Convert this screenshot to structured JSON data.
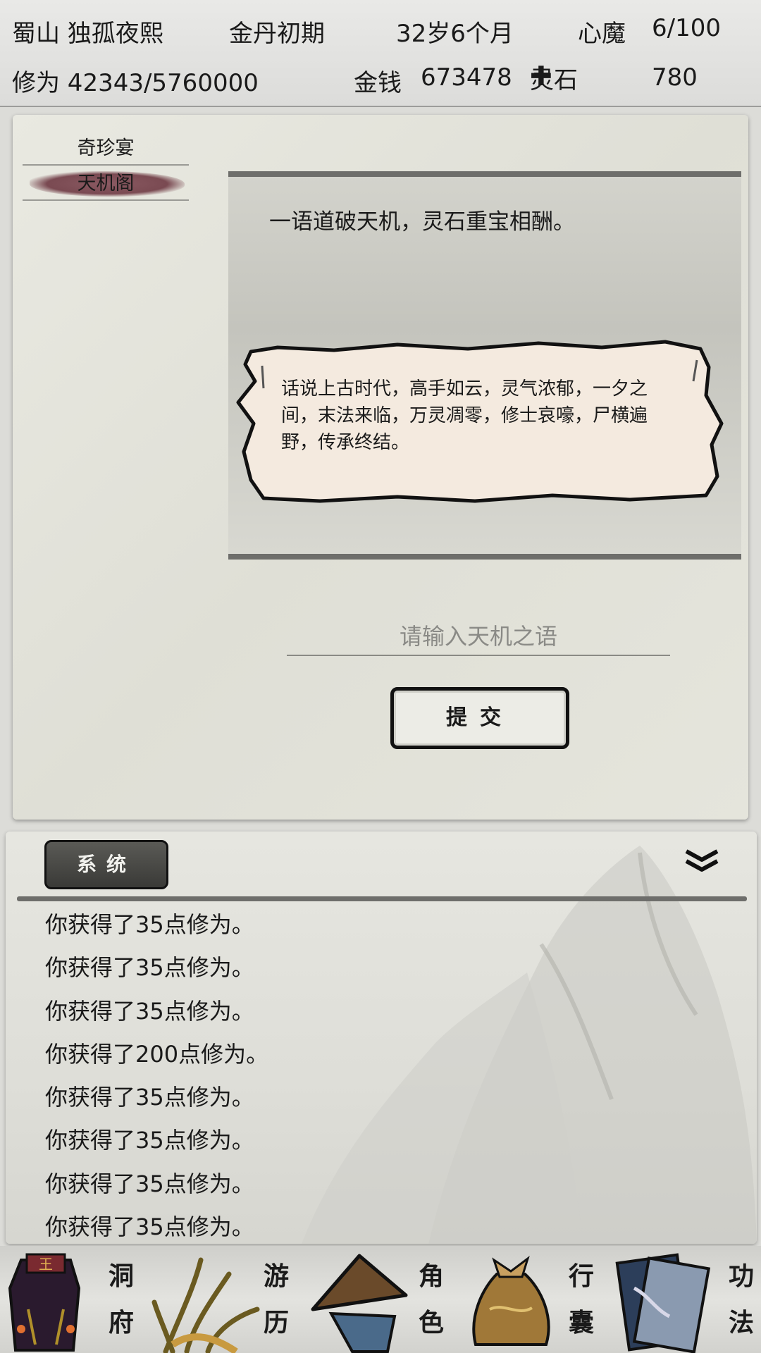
{
  "status": {
    "location_name": "蜀山 独孤夜熙",
    "realm": "金丹初期",
    "age": "32岁6个月",
    "demon_label": "心魔",
    "demon_value": "6/100",
    "cultivation": "修为 42343/5760000",
    "money_label": "金钱",
    "money_value": "673478",
    "spirit_stone_label": "灵石",
    "spirit_stone_value": "780"
  },
  "side_tabs": [
    "奇珍宴",
    "天机阁"
  ],
  "active_tab": "天机阁",
  "main": {
    "headline": "一语道破天机，灵石重宝相酬。",
    "scroll_text": "话说上古时代，高手如云，灵气浓郁，一夕之间，末法来临，万灵凋零，修士哀嚎，尸横遍野，传承终结。",
    "input_placeholder": "请输入天机之语",
    "submit_label": "提交"
  },
  "log": {
    "tab_label": "系统",
    "messages": [
      "你获得了35点修为。",
      "你获得了35点修为。",
      "你获得了35点修为。",
      "你获得了200点修为。",
      "你获得了35点修为。",
      "你获得了35点修为。",
      "你获得了35点修为。",
      "你获得了35点修为。"
    ]
  },
  "nav": {
    "dongfu": [
      "洞",
      "府"
    ],
    "youli": [
      "游",
      "历"
    ],
    "juese": [
      "角",
      "色"
    ],
    "xingnang": [
      "行",
      "囊"
    ],
    "gongfa": [
      "功",
      "法"
    ]
  },
  "icons": {
    "spirit_stone": "spirit-stone-icon",
    "collapse": "double-chevron-down-icon",
    "dongfu": "robe-icon",
    "youli": "grass-icon",
    "juese": "straw-hat-icon",
    "xingnang": "pouch-icon",
    "gongfa": "scroll-book-icon"
  }
}
